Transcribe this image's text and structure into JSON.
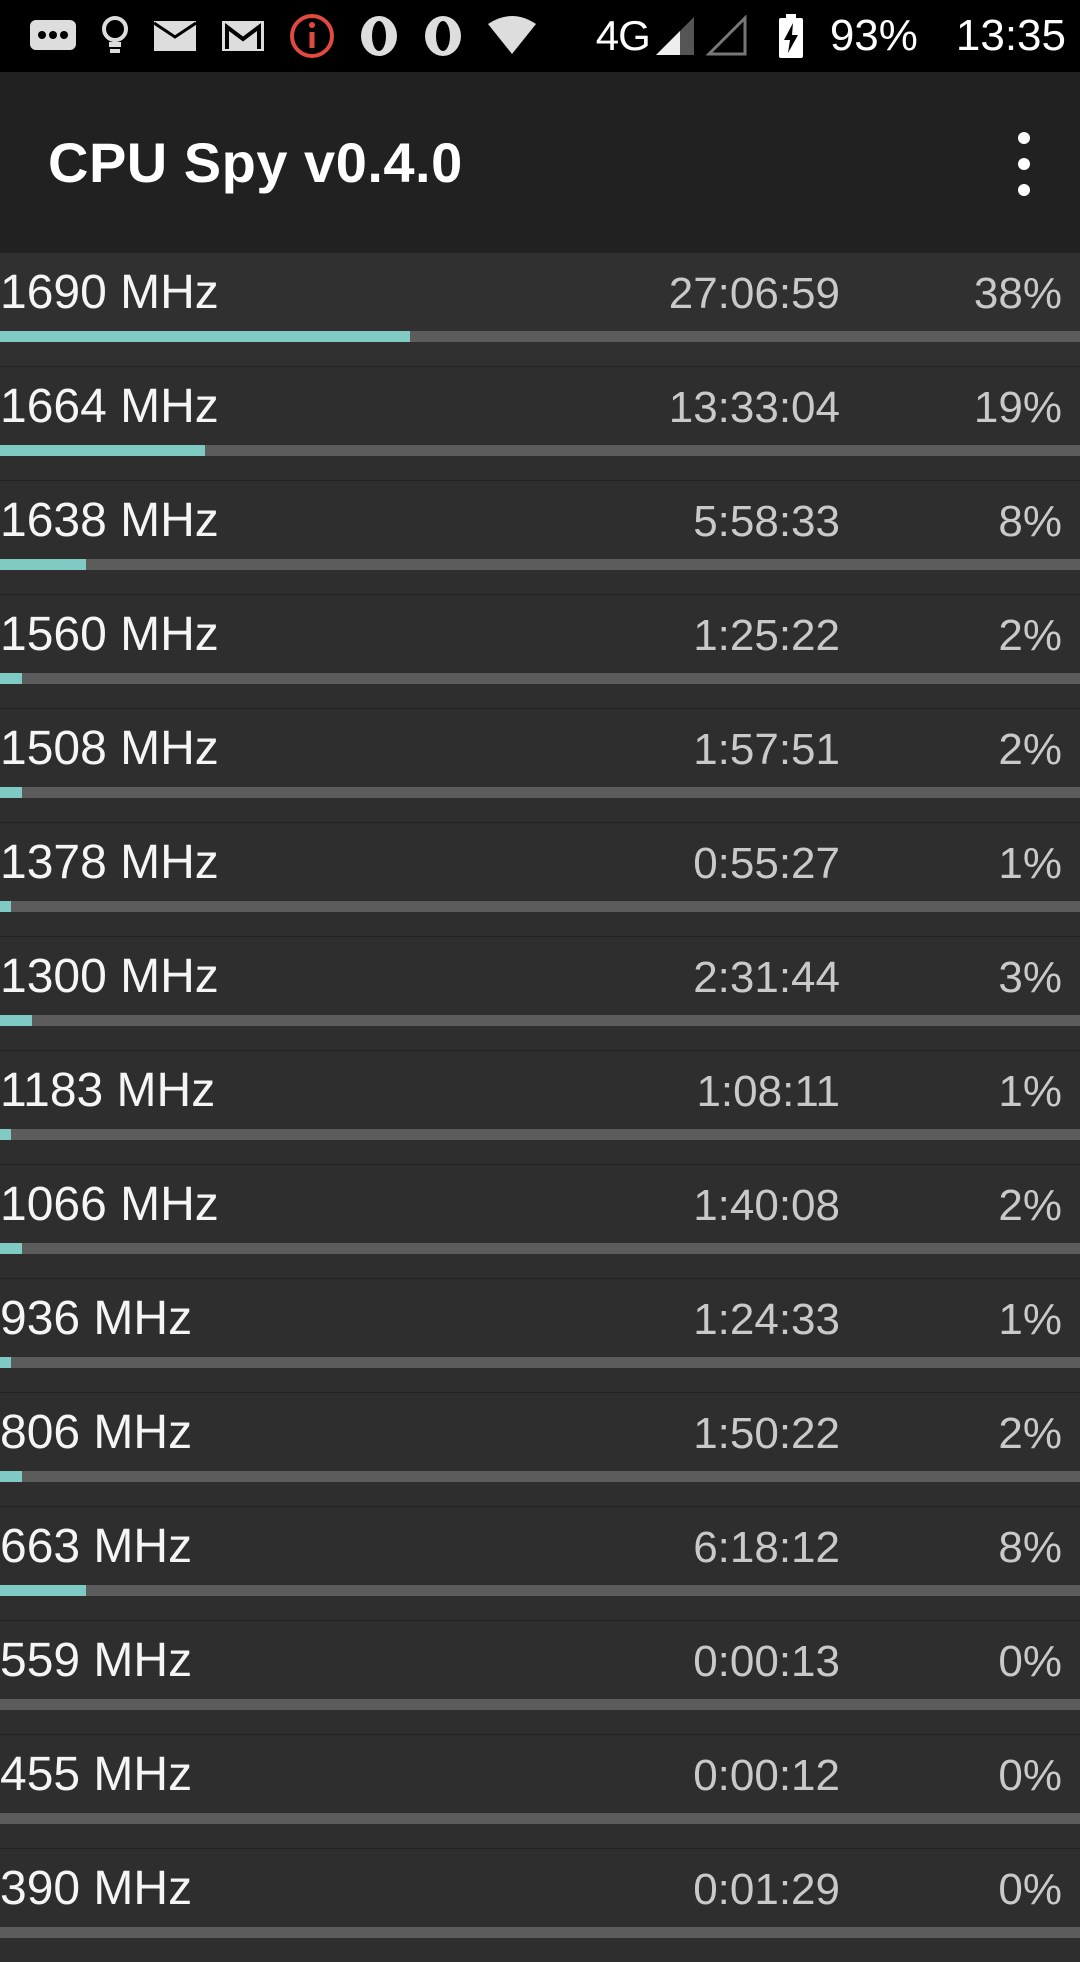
{
  "status_bar": {
    "icons": [
      "chat-icon",
      "lightbulb-icon",
      "mail-icon",
      "gmail-icon",
      "info-alert-icon",
      "opera-icon",
      "opera-icon",
      "wifi-icon"
    ],
    "network_type": "4G",
    "battery_percent": "93%",
    "time": "13:35"
  },
  "toolbar": {
    "title": "CPU Spy v0.4.0"
  },
  "accent_color": "#7fcbc4",
  "states": [
    {
      "freq": "1690 MHz",
      "duration": "27:06:59",
      "percent": "38%",
      "fraction": 0.38
    },
    {
      "freq": "1664 MHz",
      "duration": "13:33:04",
      "percent": "19%",
      "fraction": 0.19
    },
    {
      "freq": "1638 MHz",
      "duration": "5:58:33",
      "percent": "8%",
      "fraction": 0.08
    },
    {
      "freq": "1560 MHz",
      "duration": "1:25:22",
      "percent": "2%",
      "fraction": 0.02
    },
    {
      "freq": "1508 MHz",
      "duration": "1:57:51",
      "percent": "2%",
      "fraction": 0.02
    },
    {
      "freq": "1378 MHz",
      "duration": "0:55:27",
      "percent": "1%",
      "fraction": 0.01
    },
    {
      "freq": "1300 MHz",
      "duration": "2:31:44",
      "percent": "3%",
      "fraction": 0.03
    },
    {
      "freq": "1183 MHz",
      "duration": "1:08:11",
      "percent": "1%",
      "fraction": 0.01
    },
    {
      "freq": "1066 MHz",
      "duration": "1:40:08",
      "percent": "2%",
      "fraction": 0.02
    },
    {
      "freq": "936 MHz",
      "duration": "1:24:33",
      "percent": "1%",
      "fraction": 0.01
    },
    {
      "freq": "806 MHz",
      "duration": "1:50:22",
      "percent": "2%",
      "fraction": 0.02
    },
    {
      "freq": "663 MHz",
      "duration": "6:18:12",
      "percent": "8%",
      "fraction": 0.08
    },
    {
      "freq": "559 MHz",
      "duration": "0:00:13",
      "percent": "0%",
      "fraction": 0.0
    },
    {
      "freq": "455 MHz",
      "duration": "0:00:12",
      "percent": "0%",
      "fraction": 0.0
    },
    {
      "freq": "390 MHz",
      "duration": "0:01:29",
      "percent": "0%",
      "fraction": 0.0
    }
  ]
}
